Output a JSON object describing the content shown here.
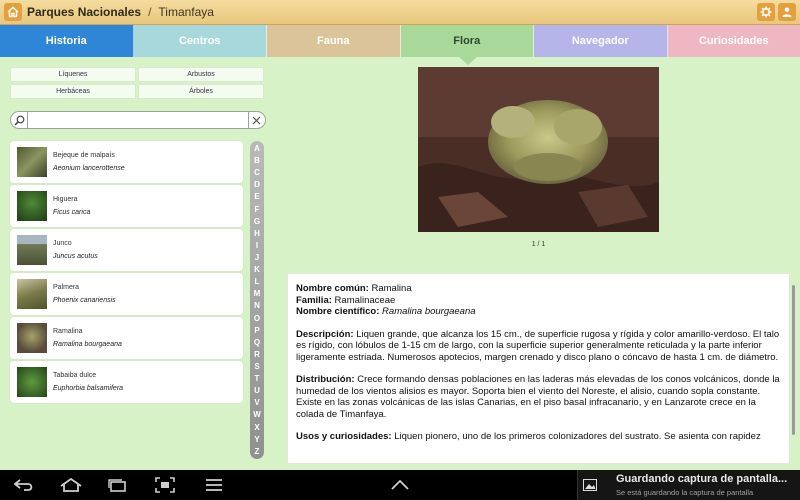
{
  "header": {
    "app_title": "Parques Nacionales",
    "separator": "/",
    "subtitle": "Timanfaya",
    "icons": [
      "home-icon",
      "settings-icon",
      "user-icon"
    ],
    "accent_color": "#e3a03c"
  },
  "tabs": [
    {
      "label": "Historia",
      "color": "#2f86d6"
    },
    {
      "label": "Centros",
      "color": "#a7d9dc"
    },
    {
      "label": "Fauna",
      "color": "#dcc49a"
    },
    {
      "label": "Flora",
      "color": "#a9d89b",
      "active": true
    },
    {
      "label": "Navegador",
      "color": "#b5b5ea"
    },
    {
      "label": "Curiosidades",
      "color": "#efb7c1"
    }
  ],
  "categories": [
    "Líquenes",
    "Arbustos",
    "Herbáceas",
    "Árboles"
  ],
  "search": {
    "value": "",
    "placeholder": ""
  },
  "species_list": [
    {
      "common": "Bejeque de malpaís",
      "scientific": "Aeonium lancerottense",
      "thumb_color": "#6f7b45"
    },
    {
      "common": "Higuera",
      "scientific": "Ficus carica",
      "thumb_color": "#2f5a22"
    },
    {
      "common": "Junco",
      "scientific": "Juncus acutus",
      "thumb_color": "#7d8b6a"
    },
    {
      "common": "Palmera",
      "scientific": "Phoenix canariensis",
      "thumb_color": "#8c8a5a"
    },
    {
      "common": "Ramalina",
      "scientific": "Ramalina bourgaeana",
      "thumb_color": "#6d6a4a"
    },
    {
      "common": "Tabaiba dulce",
      "scientific": "Euphorbia balsamifera",
      "thumb_color": "#3b6b2a"
    }
  ],
  "index_letters": [
    "A",
    "B",
    "C",
    "D",
    "E",
    "F",
    "G",
    "H",
    "I",
    "J",
    "K",
    "L",
    "M",
    "N",
    "O",
    "P",
    "Q",
    "R",
    "S",
    "T",
    "U",
    "V",
    "W",
    "X",
    "Y",
    "Z"
  ],
  "detail": {
    "image_counter": "1 / 1",
    "common_label": "Nombre común:",
    "common_value": "Ramalina",
    "family_label": "Familia:",
    "family_value": "Ramalinaceae",
    "scientific_label": "Nombre científico:",
    "scientific_value": "Ramalina bourgaeana",
    "description_label": "Descripción:",
    "description_text": "Liquen grande, que alcanza los 15 cm., de superficie rugosa y rígida y color amarillo-verdoso. El talo es rígido, con lóbulos de 1-15 cm de largo, con la superficie superior generalmente reticulada y la parte inferior ligeramente estriada. Numerosos apotecios, margen crenado y disco plano o cóncavo de hasta 1 cm. de diámetro.",
    "distribution_label": "Distribución:",
    "distribution_text": "Crece formando densas poblaciones en las laderas más elevadas de los conos volcánicos, donde la humedad de los vientos alisios es mayor. Soporta bien el viento del Noreste, el alisio, cuando sopla constante. Existe en las zonas volcánicas de las islas Canarias, en el piso basal infracanario, y en Lanzarote crece en la colada de Timanfaya.",
    "uses_label": "Usos y curiosidades:",
    "uses_text": "Liquen pionero, uno de los primeros colonizadores del sustrato. Se asienta con rapidez"
  },
  "navbar": {
    "icons": [
      "back-icon",
      "home-icon",
      "recent-apps-icon",
      "screenshot-icon",
      "menu-icon",
      "chevron-up-icon"
    ]
  },
  "notification": {
    "title": "Guardando captura de pantalla...",
    "subtitle": "Se está guardando la captura de pantalla"
  }
}
